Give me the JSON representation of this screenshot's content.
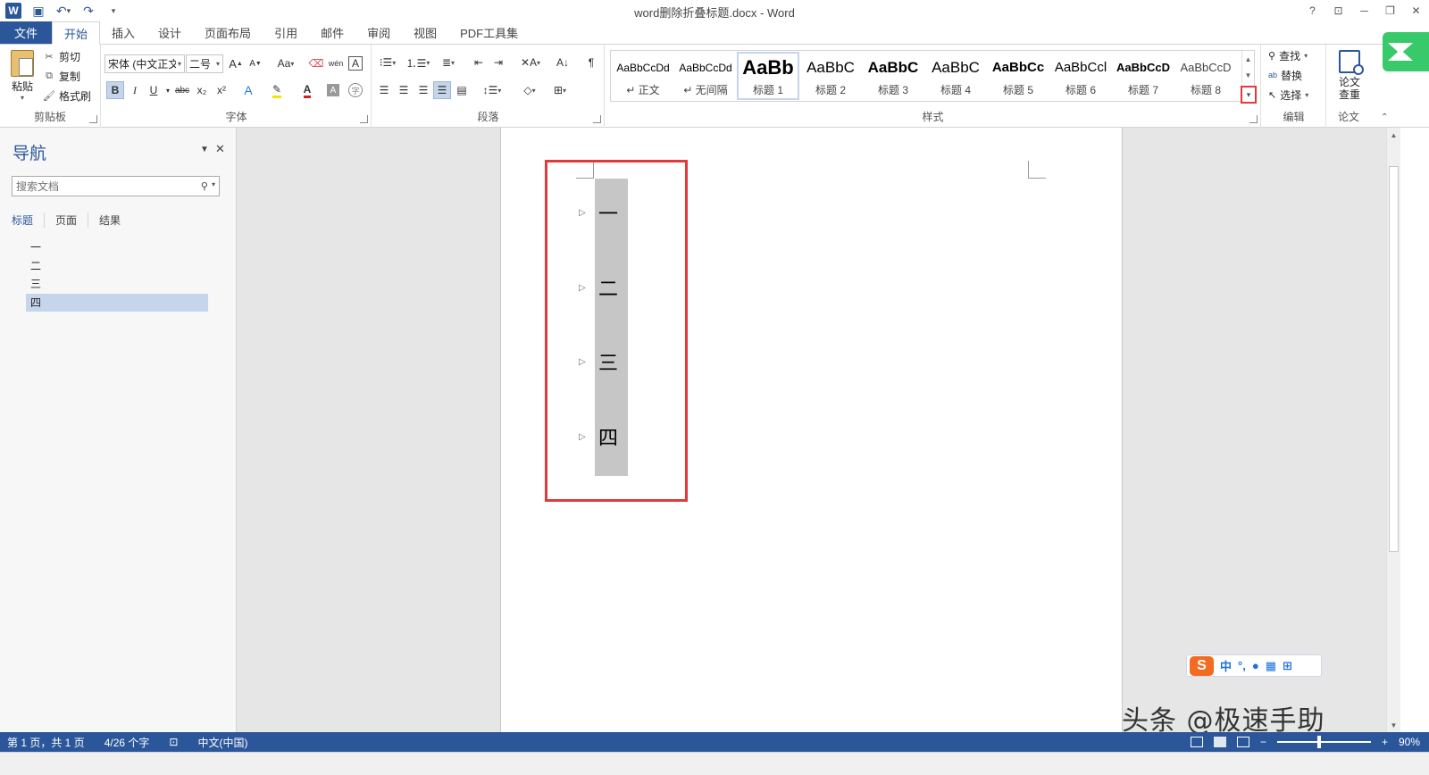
{
  "window": {
    "title": "word删除折叠标题.docx - Word",
    "help": "?",
    "min": "─",
    "restore": "❐",
    "close": "✕"
  },
  "qat": {
    "logo": "W",
    "save_icon": "save-icon",
    "undo_icon": "undo-icon",
    "redo_icon": "redo-icon"
  },
  "tabs": [
    "文件",
    "开始",
    "插入",
    "设计",
    "页面布局",
    "引用",
    "邮件",
    "审阅",
    "视图",
    "PDF工具集"
  ],
  "ribbon": {
    "clipboard": {
      "label": "剪贴板",
      "paste": "粘贴",
      "cut": "剪切",
      "copy": "复制",
      "format_painter": "格式刷"
    },
    "font": {
      "label": "字体",
      "font_name": "宋体 (中文正文",
      "font_size": "二号",
      "bold": "B",
      "italic": "I",
      "underline": "U",
      "strike": "abc",
      "sub": "x₂",
      "sup": "x²",
      "case": "Aa",
      "grow": "A",
      "shrink": "A",
      "font_color": "#d42020",
      "highlight": "#f5e400"
    },
    "paragraph": {
      "label": "段落"
    },
    "styles": {
      "label": "样式",
      "items": [
        {
          "preview": "AaBbCcDd",
          "name": "↵ 正文"
        },
        {
          "preview": "AaBbCcDd",
          "name": "↵ 无间隔"
        },
        {
          "preview": "AaBb",
          "name": "标题 1"
        },
        {
          "preview": "AaBbC",
          "name": "标题 2"
        },
        {
          "preview": "AaBbC",
          "name": "标题 3"
        },
        {
          "preview": "AaBbC",
          "name": "标题 4"
        },
        {
          "preview": "AaBbCc",
          "name": "标题 5"
        },
        {
          "preview": "AaBbCcl",
          "name": "标题 6"
        },
        {
          "preview": "AaBbCcD",
          "name": "标题 7"
        },
        {
          "preview": "AaBbCcD",
          "name": "标题 8"
        }
      ]
    },
    "editing": {
      "label": "编辑",
      "find": "查找",
      "replace": "替换",
      "select": "选择"
    },
    "paper": {
      "label": "论文",
      "check": "论文查重"
    }
  },
  "nav": {
    "title": "导航",
    "search_placeholder": "搜索文档",
    "tabs": [
      "标题",
      "页面",
      "结果"
    ],
    "items": [
      "一",
      "二",
      "三",
      "四"
    ]
  },
  "document": {
    "headings": [
      "一",
      "二",
      "三",
      "四"
    ]
  },
  "ime": {
    "lang": "中",
    "punct": "°,",
    "mic_icon": "mic-icon",
    "keyboard_icon": "keyboard-icon",
    "grid_icon": "grid-icon"
  },
  "watermark": "头条 @极速手助",
  "status": {
    "page": "第 1 页，共 1 页",
    "words": "4/26 个字",
    "lang": "中文(中国)",
    "zoom": "90%",
    "zoom_level": 0.43
  }
}
